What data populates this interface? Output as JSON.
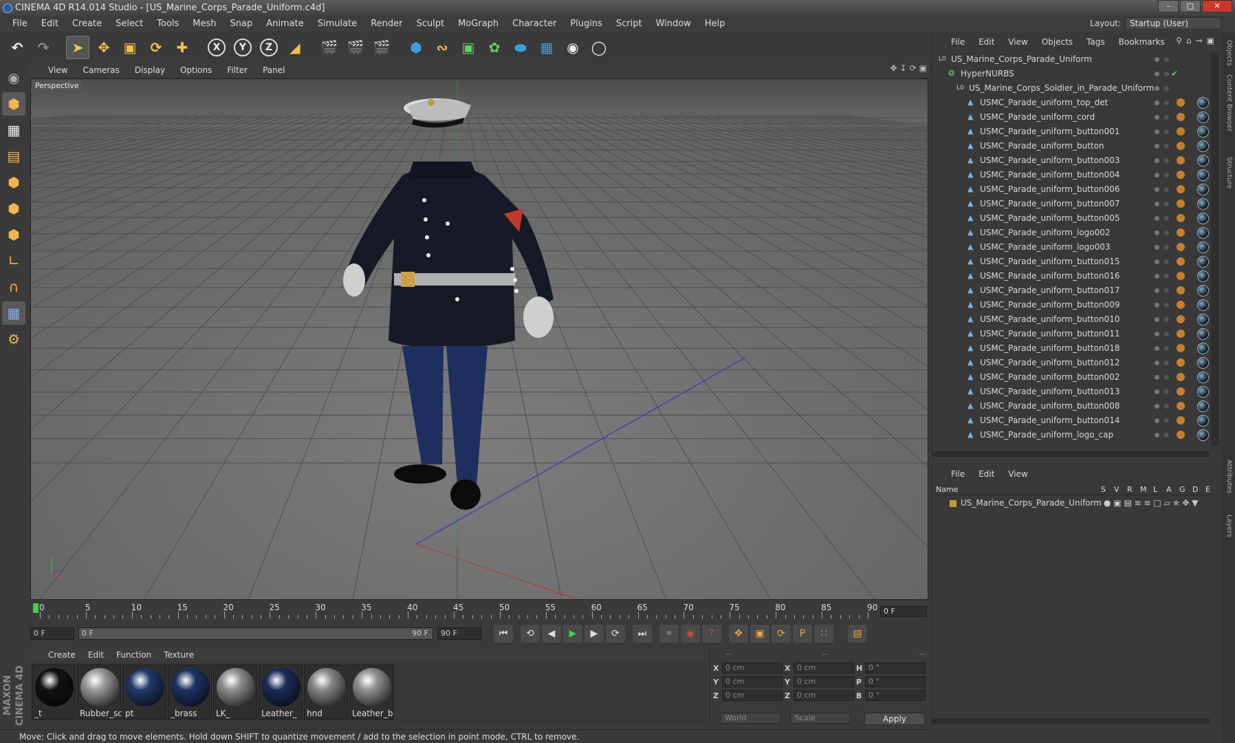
{
  "window": {
    "title": "CINEMA 4D R14.014 Studio - [US_Marine_Corps_Parade_Uniform.c4d]",
    "min": "–",
    "max": "□",
    "close": "✕"
  },
  "menubar": {
    "items": [
      "File",
      "Edit",
      "Create",
      "Select",
      "Tools",
      "Mesh",
      "Snap",
      "Animate",
      "Simulate",
      "Render",
      "Sculpt",
      "MoGraph",
      "Character",
      "Plugins",
      "Script",
      "Window",
      "Help"
    ]
  },
  "layout": {
    "label": "Layout:",
    "value": "Startup (User)"
  },
  "toolbar": {
    "icons": [
      "undo-icon",
      "redo-icon",
      "live-selection-icon",
      "move-icon",
      "scale-icon",
      "rotate-icon",
      "create-object-icon",
      "x-axis-lock-icon",
      "y-axis-lock-icon",
      "z-axis-lock-icon",
      "coordinate-system-icon",
      "render-view-icon",
      "render-picture-viewer-icon",
      "render-settings-icon",
      "cube-primitive-icon",
      "spline-pen-icon",
      "subdivision-surface-icon",
      "cloner-icon",
      "deformer-icon",
      "floor-icon",
      "camera-icon",
      "light-icon"
    ],
    "axis_labels": [
      "X",
      "Y",
      "Z"
    ]
  },
  "viewport": {
    "menu": [
      "View",
      "Cameras",
      "Display",
      "Options",
      "Filter",
      "Panel"
    ],
    "label": "Perspective"
  },
  "timeline": {
    "ticks": [
      "0",
      "5",
      "10",
      "15",
      "20",
      "25",
      "30",
      "35",
      "40",
      "45",
      "50",
      "55",
      "60",
      "65",
      "70",
      "75",
      "80",
      "85",
      "90"
    ],
    "current_frame": "0 F",
    "start": "0 F",
    "range_start": "0 F",
    "range_end": "90 F",
    "end": "90 F"
  },
  "materials": {
    "menu": [
      "Create",
      "Edit",
      "Function",
      "Texture"
    ],
    "items": [
      {
        "name": "_t",
        "color": "#111"
      },
      {
        "name": "Rubber_so",
        "color": "#9a9a9a"
      },
      {
        "name": "pt",
        "color": "#203a6a"
      },
      {
        "name": "_brass",
        "color": "#1d3266"
      },
      {
        "name": "LK_",
        "color": "#8e8e8e"
      },
      {
        "name": "Leather_",
        "color": "#1c2c58"
      },
      {
        "name": "hnd",
        "color": "#888"
      },
      {
        "name": "Leather_bo",
        "color": "#909090"
      }
    ]
  },
  "coordinates": {
    "header": [
      "--",
      "--",
      "--"
    ],
    "rows": [
      {
        "a": "X",
        "av": "0 cm",
        "b": "X",
        "bv": "0 cm",
        "c": "H",
        "cv": "0 °"
      },
      {
        "a": "Y",
        "av": "0 cm",
        "b": "Y",
        "bv": "0 cm",
        "c": "P",
        "cv": "0 °"
      },
      {
        "a": "Z",
        "av": "0 cm",
        "b": "Z",
        "bv": "0 cm",
        "c": "B",
        "cv": "0 °"
      }
    ],
    "world": "World",
    "scale": "Scale",
    "apply": "Apply"
  },
  "status": "Move: Click and drag to move elements. Hold down SHIFT to quantize movement / add to the selection in point mode, CTRL to remove.",
  "brand": "MAXON CINEMA 4D",
  "objects": {
    "menu": [
      "File",
      "Edit",
      "View",
      "Objects",
      "Tags",
      "Bookmarks"
    ],
    "items": [
      {
        "name": "US_Marine_Corps_Parade_Uniform",
        "level": 0,
        "kind": "null"
      },
      {
        "name": "HyperNURBS",
        "level": 1,
        "kind": "nurbs"
      },
      {
        "name": "US_Marine_Corps_Soldier_in_Parade_Uniform",
        "level": 2,
        "kind": "null"
      },
      {
        "name": "USMC_Parade_uniform_top_det",
        "level": 3,
        "kind": "poly"
      },
      {
        "name": "USMC_Parade_uniform_cord",
        "level": 3,
        "kind": "poly"
      },
      {
        "name": "USMC_Parade_uniform_button001",
        "level": 3,
        "kind": "poly"
      },
      {
        "name": "USMC_Parade_uniform_button",
        "level": 3,
        "kind": "poly"
      },
      {
        "name": "USMC_Parade_uniform_button003",
        "level": 3,
        "kind": "poly"
      },
      {
        "name": "USMC_Parade_uniform_button004",
        "level": 3,
        "kind": "poly"
      },
      {
        "name": "USMC_Parade_uniform_button006",
        "level": 3,
        "kind": "poly"
      },
      {
        "name": "USMC_Parade_uniform_button007",
        "level": 3,
        "kind": "poly"
      },
      {
        "name": "USMC_Parade_uniform_button005",
        "level": 3,
        "kind": "poly"
      },
      {
        "name": "USMC_Parade_uniform_logo002",
        "level": 3,
        "kind": "poly"
      },
      {
        "name": "USMC_Parade_uniform_logo003",
        "level": 3,
        "kind": "poly"
      },
      {
        "name": "USMC_Parade_uniform_button015",
        "level": 3,
        "kind": "poly"
      },
      {
        "name": "USMC_Parade_uniform_button016",
        "level": 3,
        "kind": "poly"
      },
      {
        "name": "USMC_Parade_uniform_button017",
        "level": 3,
        "kind": "poly"
      },
      {
        "name": "USMC_Parade_uniform_button009",
        "level": 3,
        "kind": "poly"
      },
      {
        "name": "USMC_Parade_uniform_button010",
        "level": 3,
        "kind": "poly"
      },
      {
        "name": "USMC_Parade_uniform_button011",
        "level": 3,
        "kind": "poly"
      },
      {
        "name": "USMC_Parade_uniform_button018",
        "level": 3,
        "kind": "poly"
      },
      {
        "name": "USMC_Parade_uniform_button012",
        "level": 3,
        "kind": "poly"
      },
      {
        "name": "USMC_Parade_uniform_button002",
        "level": 3,
        "kind": "poly"
      },
      {
        "name": "USMC_Parade_uniform_button013",
        "level": 3,
        "kind": "poly"
      },
      {
        "name": "USMC_Parade_uniform_button008",
        "level": 3,
        "kind": "poly"
      },
      {
        "name": "USMC_Parade_uniform_button014",
        "level": 3,
        "kind": "poly"
      },
      {
        "name": "USMC_Parade_uniform_logo_cap",
        "level": 3,
        "kind": "poly"
      }
    ]
  },
  "layers": {
    "menu": [
      "File",
      "Edit",
      "View"
    ],
    "columns": [
      "Name",
      "S",
      "V",
      "R",
      "M",
      "L",
      "A",
      "G",
      "D",
      "E"
    ],
    "row": "US_Marine_Corps_Parade_Uniform"
  },
  "side_tabs": [
    "Objects",
    "Content Browser",
    "Structure",
    "Attributes",
    "Layers"
  ]
}
